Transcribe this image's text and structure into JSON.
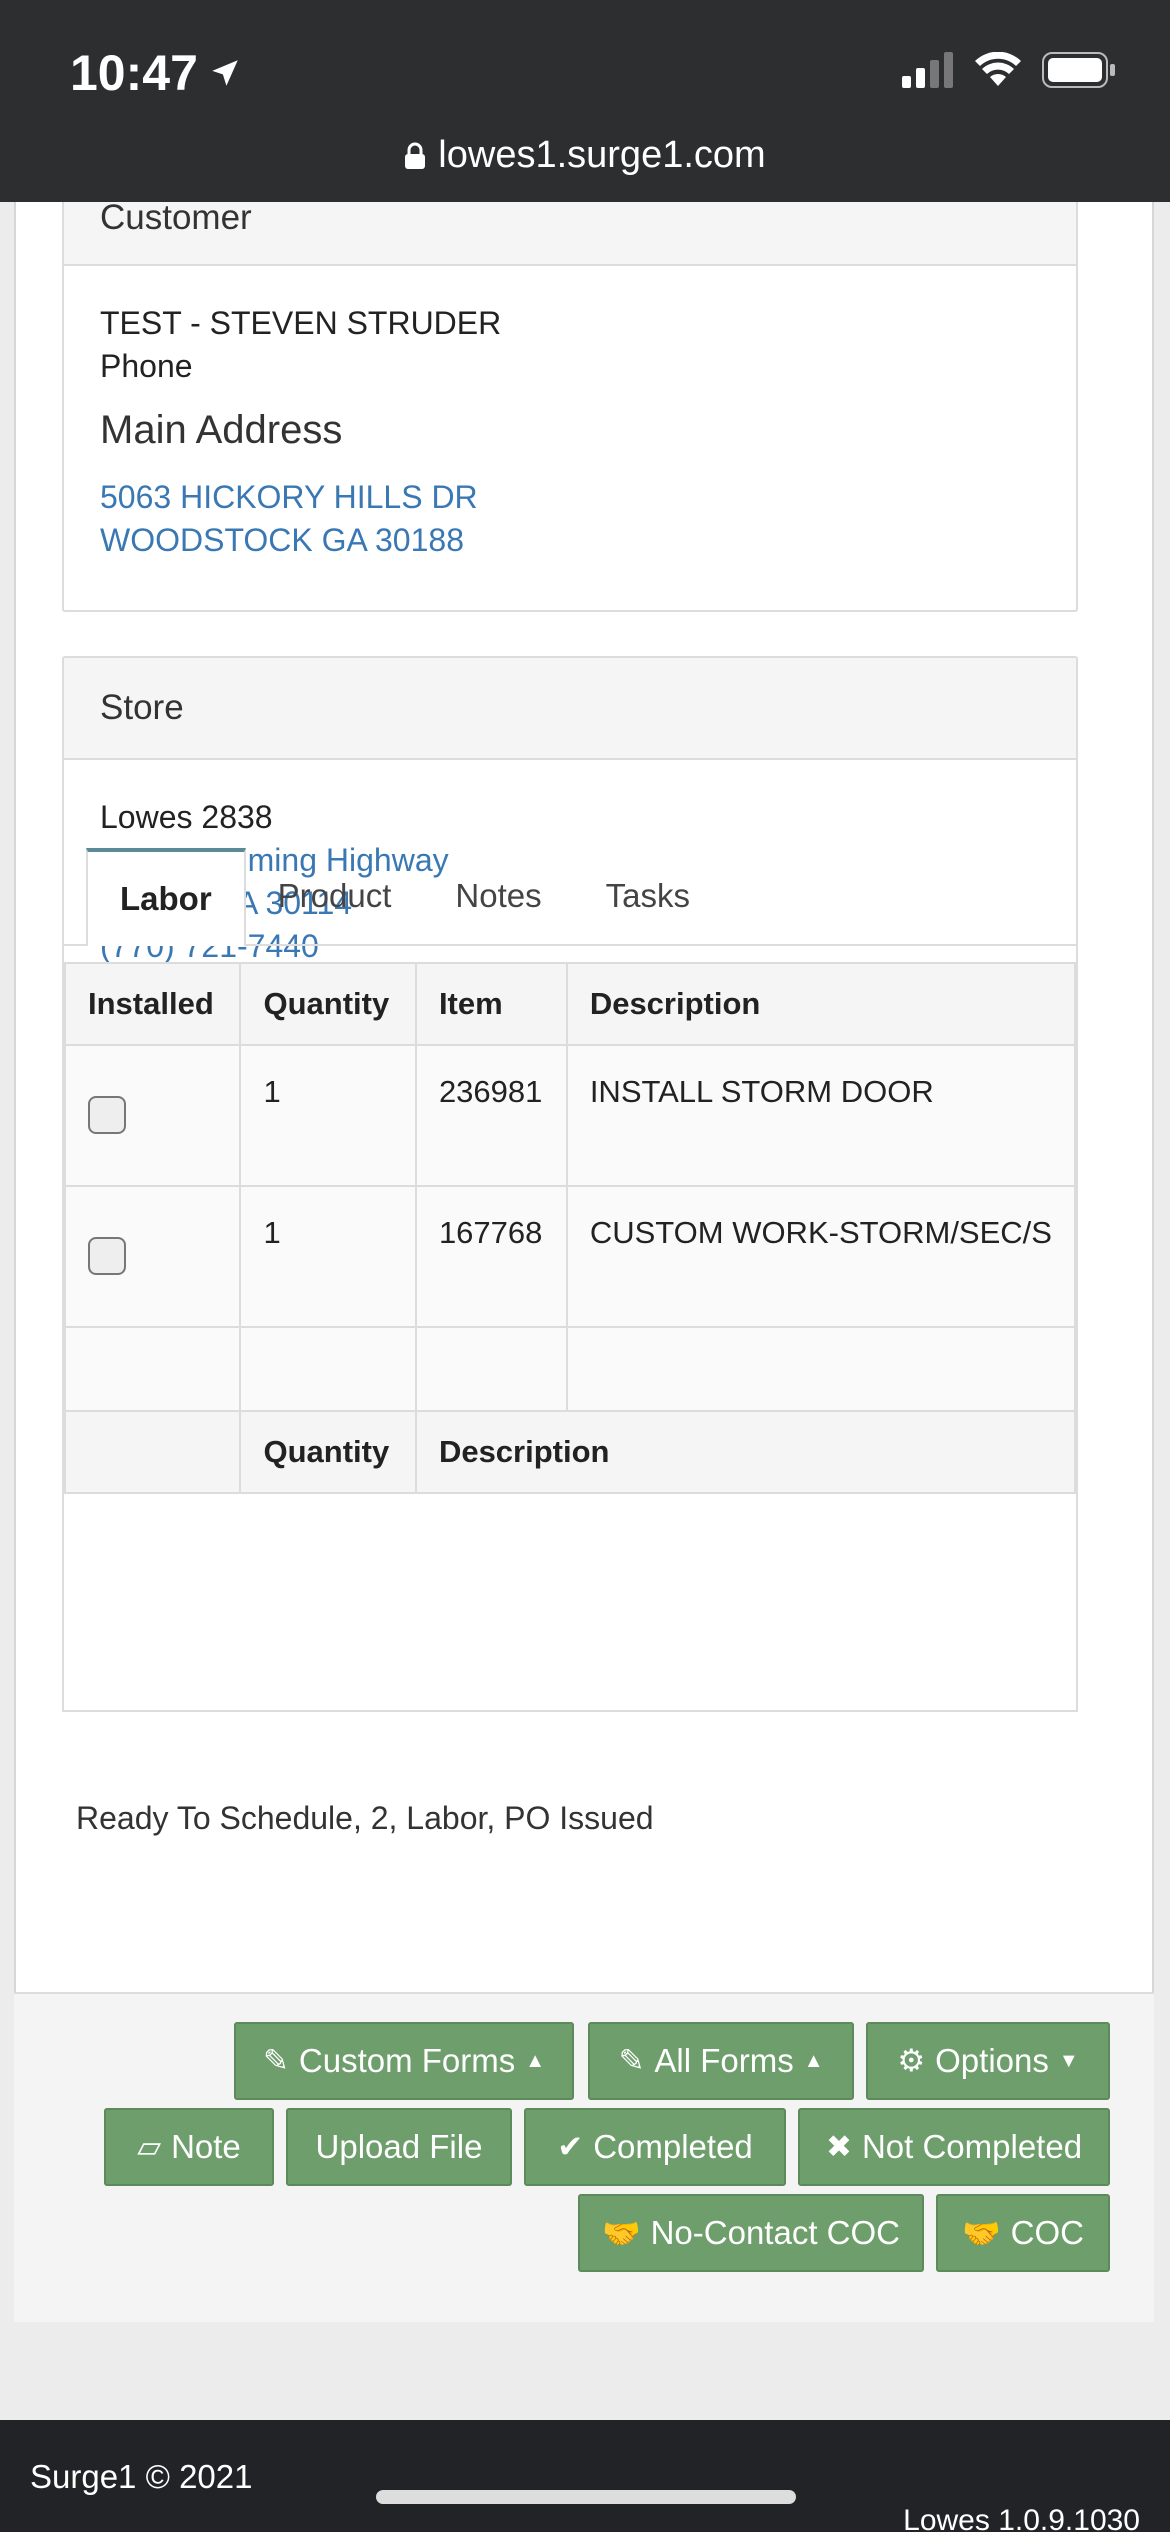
{
  "status_bar": {
    "time": "10:47",
    "url": "lowes1.surge1.com"
  },
  "customer": {
    "heading": "Customer",
    "name": "TEST - STEVEN STRUDER",
    "phone_label": "Phone",
    "address_title": "Main Address",
    "address_line1": "5063 HICKORY HILLS DR",
    "address_line2": "WOODSTOCK GA 30188"
  },
  "store": {
    "heading": "Store",
    "name": "Lowes 2838",
    "street": "2044 Cumming Highway",
    "city": "Canton GA 30114",
    "phone": "(770) 721-7440"
  },
  "tabs": [
    {
      "label": "Labor"
    },
    {
      "label": "Product"
    },
    {
      "label": "Notes"
    },
    {
      "label": "Tasks"
    }
  ],
  "labor_table": {
    "headers": [
      "Installed",
      "Quantity",
      "Item",
      "Description"
    ],
    "rows": [
      {
        "quantity": "1",
        "item": "236981",
        "description": "INSTALL STORM DOOR"
      },
      {
        "quantity": "1",
        "item": "167768",
        "description": "CUSTOM WORK-STORM/SEC/S"
      }
    ],
    "sub_headers": [
      "Quantity",
      "Description"
    ]
  },
  "status_text": "Ready To Schedule, 2, Labor, PO Issued",
  "actions": {
    "custom_forms": "Custom Forms",
    "all_forms": "All Forms",
    "options": "Options",
    "note": "Note",
    "upload_file": "Upload File",
    "completed": "Completed",
    "not_completed": "Not Completed",
    "no_contact_coc": "No-Contact COC",
    "coc": "COC"
  },
  "footer": {
    "copyright": "Surge1 © 2021",
    "version": "Lowes 1.0.9.1030"
  },
  "colors": {
    "button_green": "#6e9e6c",
    "link_blue": "#3a78b4",
    "tab_accent": "#5b8a96"
  }
}
